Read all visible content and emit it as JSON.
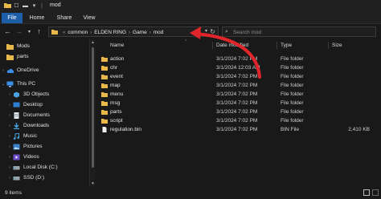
{
  "window": {
    "title": "mod"
  },
  "ribbon": {
    "tabs": [
      "File",
      "Home",
      "Share",
      "View"
    ]
  },
  "address": {
    "crumbs": [
      "common",
      "ELDEN RING",
      "Game",
      "mod"
    ]
  },
  "search": {
    "placeholder": "Search mod"
  },
  "nav_pane": {
    "items": [
      {
        "label": "Mods",
        "icon": "folder-icon"
      },
      {
        "label": "parts",
        "icon": "folder-icon"
      },
      {
        "label": "OneDrive",
        "icon": "cloud-icon"
      },
      {
        "label": "This PC",
        "icon": "computer-icon"
      },
      {
        "label": "3D Objects",
        "icon": "cube-icon"
      },
      {
        "label": "Desktop",
        "icon": "desktop-icon"
      },
      {
        "label": "Documents",
        "icon": "document-icon"
      },
      {
        "label": "Downloads",
        "icon": "download-icon"
      },
      {
        "label": "Music",
        "icon": "music-icon"
      },
      {
        "label": "Pictures",
        "icon": "pictures-icon"
      },
      {
        "label": "Videos",
        "icon": "videos-icon"
      },
      {
        "label": "Local Disk (C:)",
        "icon": "drive-icon"
      },
      {
        "label": "SSD (D:)",
        "icon": "drive-icon"
      }
    ]
  },
  "columns": {
    "name": "Name",
    "date": "Date modified",
    "type": "Type",
    "size": "Size"
  },
  "files": [
    {
      "name": "action",
      "date": "3/1/2024 7:02 PM",
      "type": "File folder",
      "size": "",
      "kind": "folder"
    },
    {
      "name": "chr",
      "date": "3/1/2024 12:03 AM",
      "type": "File folder",
      "size": "",
      "kind": "folder"
    },
    {
      "name": "event",
      "date": "3/1/2024 7:02 PM",
      "type": "File folder",
      "size": "",
      "kind": "folder"
    },
    {
      "name": "map",
      "date": "3/1/2024 7:02 PM",
      "type": "File folder",
      "size": "",
      "kind": "folder"
    },
    {
      "name": "menu",
      "date": "3/1/2024 7:02 PM",
      "type": "File folder",
      "size": "",
      "kind": "folder"
    },
    {
      "name": "msg",
      "date": "3/1/2024 7:02 PM",
      "type": "File folder",
      "size": "",
      "kind": "folder"
    },
    {
      "name": "parts",
      "date": "3/1/2024 7:02 PM",
      "type": "File folder",
      "size": "",
      "kind": "folder"
    },
    {
      "name": "script",
      "date": "3/1/2024 7:02 PM",
      "type": "File folder",
      "size": "",
      "kind": "folder"
    },
    {
      "name": "regulation.bin",
      "date": "3/1/2024 7:02 PM",
      "type": "BIN File",
      "size": "2,410 KB",
      "kind": "file"
    }
  ],
  "status": {
    "item_count": "9 items"
  },
  "colors": {
    "folder": "#e8b84a",
    "accent": "#1c5fa8",
    "arrow": "#e0262b"
  }
}
